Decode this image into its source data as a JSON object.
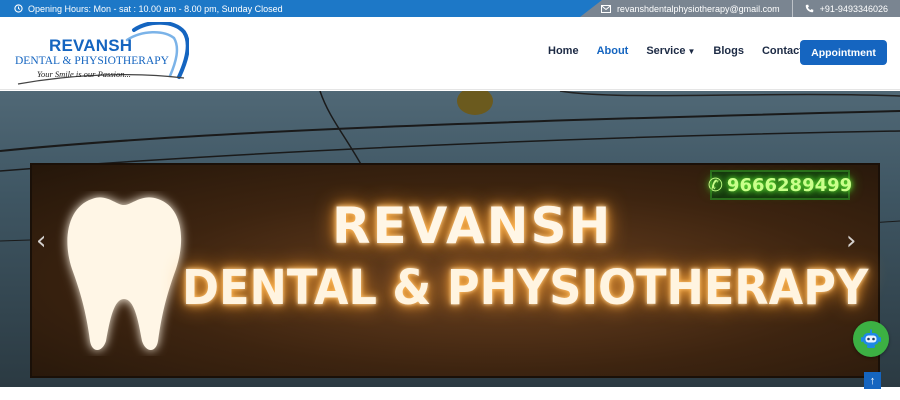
{
  "topbar": {
    "hours": "Opening Hours: Mon - sat : 10.00 am - 8.00 pm, Sunday Closed",
    "email": "revanshdentalphysiotherapy@gmail.com",
    "phone": "+91-9493346026",
    "icons": [
      "clock-icon",
      "mail-icon",
      "phone-icon"
    ]
  },
  "logo": {
    "line1": "REVANSH",
    "line2": "DENTAL & PHYSIOTHERAPY",
    "tagline": "Your Smile is our Passion..."
  },
  "nav": {
    "items": [
      {
        "label": "Home",
        "active": false
      },
      {
        "label": "About",
        "active": true
      },
      {
        "label": "Service",
        "active": false,
        "dropdown": true
      },
      {
        "label": "Blogs",
        "active": false
      },
      {
        "label": "Contact",
        "active": false
      }
    ],
    "cta": "Appointment"
  },
  "hero": {
    "sign_line1": "REVANSH",
    "sign_line2": "DENTAL & PHYSIOTHERAPY",
    "sign_phone": "9666289499",
    "prev_arrow": "‹",
    "next_arrow": "›"
  },
  "floating": {
    "chat_icon": "chat-robot-icon",
    "scroll_top_icon": "arrow-up-icon",
    "scroll_top_glyph": "↑"
  },
  "colors": {
    "brand_blue": "#1565c0",
    "topbar_blue": "#1d78c7",
    "topbar_grey": "#7a8591",
    "chat_green": "#3cb043"
  }
}
